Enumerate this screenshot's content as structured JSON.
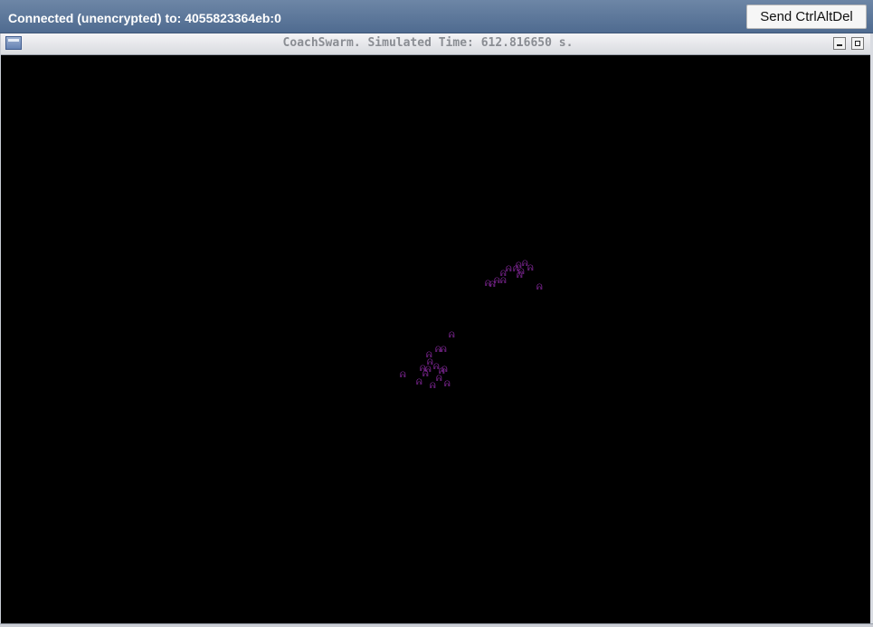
{
  "vnc": {
    "status": "Connected (unencrypted) to: 4055823364eb:0",
    "ctrlaltdel_label": "Send CtrlAltDel"
  },
  "window": {
    "title": "CoachSwarm. Simulated Time: 612.816650 s."
  },
  "simulation": {
    "agent_glyph": "ᕱ",
    "agent_color": "#8a2aa2",
    "background": "#000000",
    "agent_count": 29
  }
}
